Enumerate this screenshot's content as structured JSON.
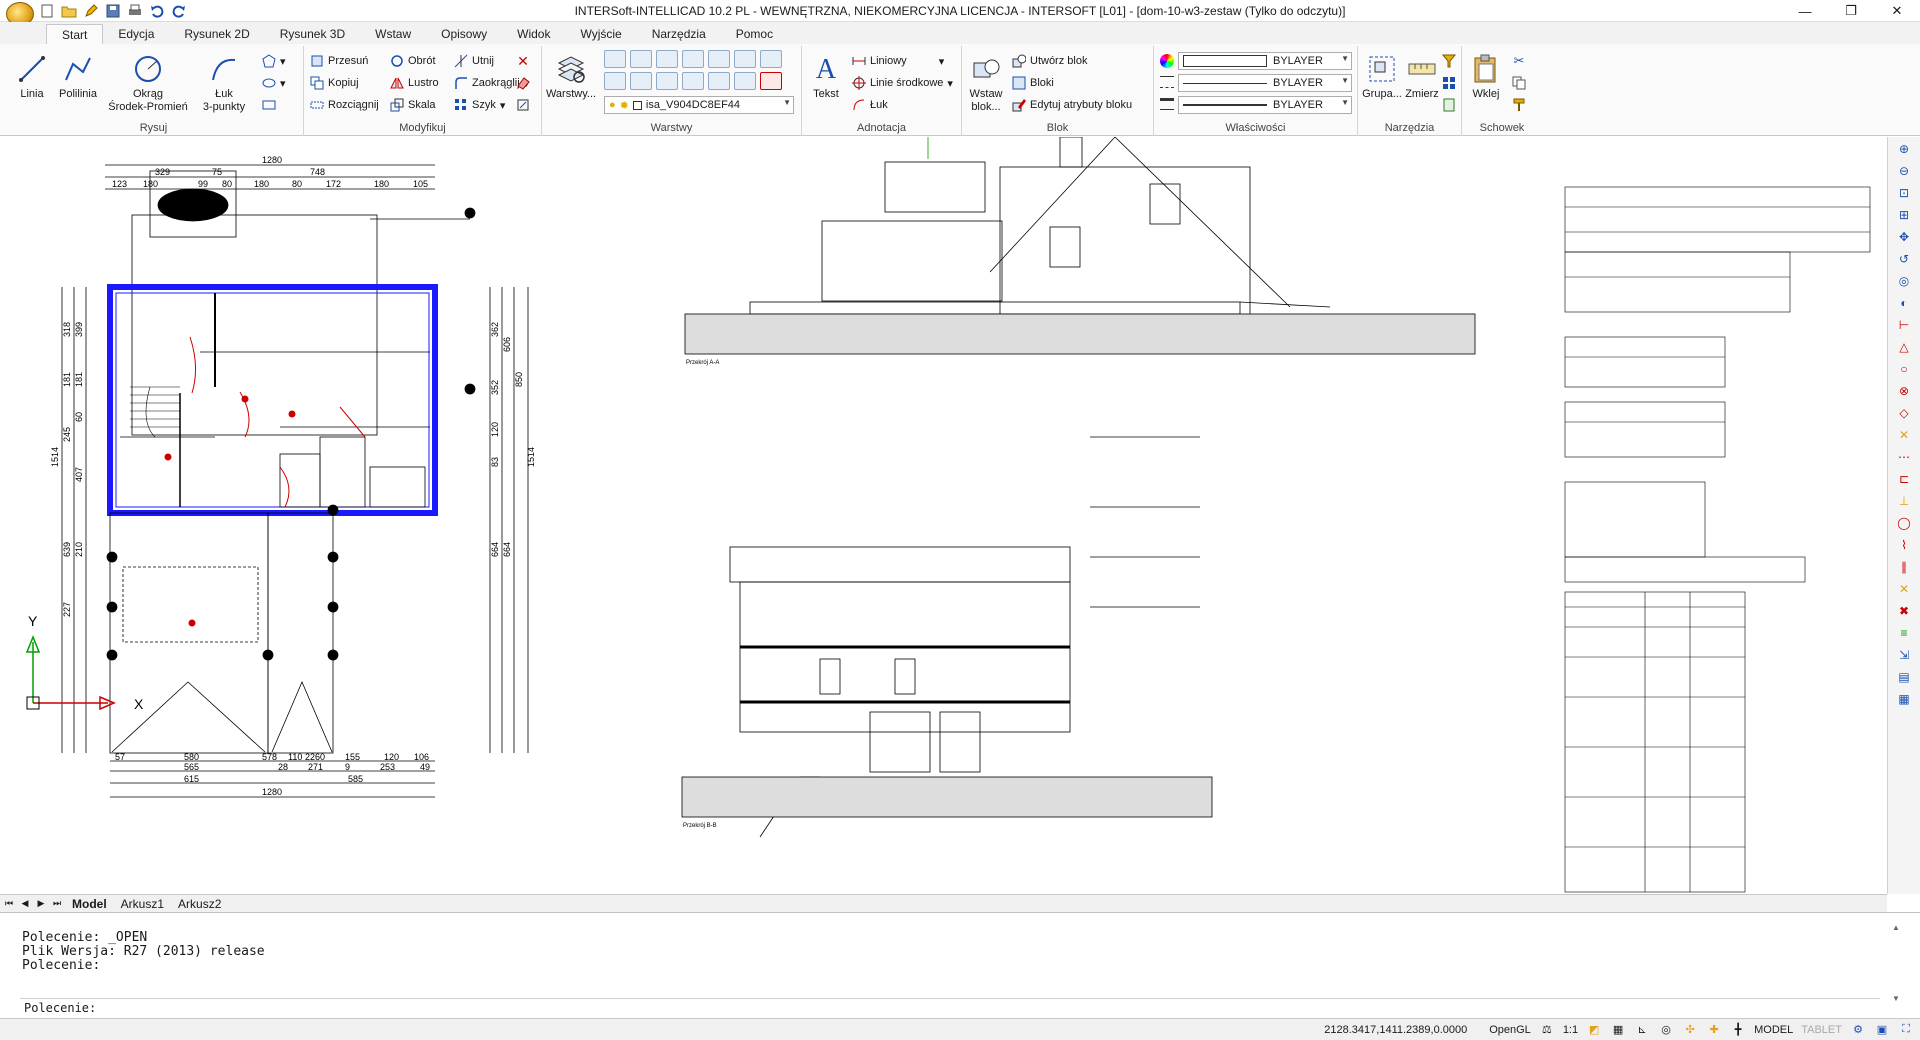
{
  "window": {
    "title": "INTERSoft-INTELLICAD 10.2 PL - WEWNĘTRZNA, NIEKOMERCYJNA LICENCJA - INTERSOFT [L01] - [dom-10-w3-zestaw (Tylko do odczytu)]",
    "minimize": "—",
    "restore": "❐",
    "close": "✕"
  },
  "tabs": [
    "Start",
    "Edycja",
    "Rysunek 2D",
    "Rysunek 3D",
    "Wstaw",
    "Opisowy",
    "Widok",
    "Wyjście",
    "Narzędzia",
    "Pomoc"
  ],
  "ribbon": {
    "rysuj": {
      "label": "Rysuj",
      "linia": "Linia",
      "polilinia": "Polilinia",
      "okrag": "Okrąg\nŚrodek-Promień",
      "luk": "Łuk\n3-punkty"
    },
    "modyfikuj": {
      "label": "Modyfikuj",
      "przesun": "Przesuń",
      "obrot": "Obrót",
      "utnij": "Utnij",
      "kopiuj": "Kopiuj",
      "lustro": "Lustro",
      "zaokraglij": "Zaokrąglij",
      "rozciagnij": "Rozciągnij",
      "skala": "Skala",
      "szyk": "Szyk"
    },
    "warstwy": {
      "label": "Warstwy",
      "warstwy_btn": "Warstwy...",
      "current_layer": "isa_V904DC8EF44"
    },
    "adnotacja": {
      "label": "Adnotacja",
      "tekst": "Tekst",
      "liniowy": "Liniowy",
      "linie_srodkowe": "Linie środkowe",
      "luk": "Łuk"
    },
    "blok": {
      "label": "Blok",
      "wstaw": "Wstaw\nblok...",
      "utworz": "Utwórz blok",
      "bloki": "Bloki",
      "edytuj": "Edytuj atrybuty bloku"
    },
    "wlasciwosci": {
      "label": "Właściwości",
      "color": "BYLAYER",
      "linetype": "BYLAYER",
      "lineweight": "BYLAYER"
    },
    "narzedzia": {
      "label": "Narzędzia",
      "grupa": "Grupa...",
      "zmierz": "Zmierz"
    },
    "schowek": {
      "label": "Schowek",
      "wklej": "Wklej"
    }
  },
  "drawing": {
    "axis_y": "Y",
    "axis_x": "X",
    "dims_top": [
      "1280",
      "329",
      "75",
      "748",
      "123",
      "180",
      "99",
      "80",
      "180",
      "80",
      "172",
      "180",
      "105"
    ],
    "dims_bottom": [
      "57",
      "580",
      "578",
      "110",
      "2260",
      "155",
      "120",
      "106",
      "565",
      "28",
      "271",
      "9",
      "253",
      "49",
      "615",
      "585",
      "1280"
    ],
    "dims_left": [
      "318",
      "399",
      "181",
      "181",
      "60",
      "245",
      "407",
      "1514",
      "639",
      "210",
      "227"
    ],
    "dims_right": [
      "362",
      "606",
      "850",
      "352",
      "120",
      "83",
      "1514",
      "664",
      "664"
    ],
    "section_caption_a": "Przekrój A-A",
    "section_caption_b": "Przekrój B-B"
  },
  "sheets": [
    "Model",
    "Arkusz1",
    "Arkusz2"
  ],
  "command": {
    "history": [
      "Polecenie: _OPEN",
      "Plik Wersja: R27 (2013) release",
      "Polecenie:"
    ],
    "prompt": "Polecenie:"
  },
  "status": {
    "coords": "2128.3417,1411.2389,0.0000",
    "renderer": "OpenGL",
    "scale": "1:1",
    "mode": "MODEL",
    "tablet": "TABLET"
  },
  "colors": {
    "wall": "#1a1aff",
    "accent_red": "#cc0000",
    "ucs_green": "#00a000"
  }
}
